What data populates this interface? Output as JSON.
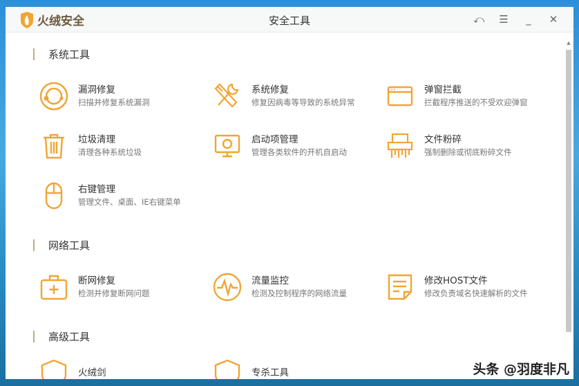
{
  "app": {
    "name": "火绒安全",
    "title": "安全工具"
  },
  "window_controls": [
    "back",
    "menu",
    "minimize",
    "close"
  ],
  "accent": "#f0a534",
  "sections": [
    {
      "label": "系统工具",
      "items": [
        {
          "name": "漏洞修复",
          "desc": "扫描并修复系统漏洞",
          "icon": "vulnerability-icon"
        },
        {
          "name": "系统修复",
          "desc": "修复因病毒等导致的系统异常",
          "icon": "tools-icon"
        },
        {
          "name": "弹窗拦截",
          "desc": "拦截程序推送的不受欢迎弹窗",
          "icon": "popup-window-icon"
        },
        {
          "name": "垃圾清理",
          "desc": "清理各种系统垃圾",
          "icon": "trash-icon"
        },
        {
          "name": "启动项管理",
          "desc": "管理各类软件的开机自启动",
          "icon": "monitor-icon"
        },
        {
          "name": "文件粉碎",
          "desc": "强制删除或彻底粉碎文件",
          "icon": "shredder-icon"
        },
        {
          "name": "右键管理",
          "desc": "管理文件、桌面、IE右键菜单",
          "icon": "mouse-icon"
        }
      ]
    },
    {
      "label": "网络工具",
      "items": [
        {
          "name": "断网修复",
          "desc": "检测并修复断网问题",
          "icon": "first-aid-kit-icon"
        },
        {
          "name": "流量监控",
          "desc": "检测及控制程序的网络流量",
          "icon": "traffic-pulse-icon"
        },
        {
          "name": "修改HOST文件",
          "desc": "修改负责域名快速解析的文件",
          "icon": "document-icon"
        }
      ]
    },
    {
      "label": "高级工具",
      "items": [
        {
          "name": "火绒剑",
          "desc": "",
          "icon": "shield-icon"
        },
        {
          "name": "专杀工具",
          "desc": "",
          "icon": "shield-icon"
        }
      ]
    }
  ],
  "watermark": "头条 @羽度非凡"
}
